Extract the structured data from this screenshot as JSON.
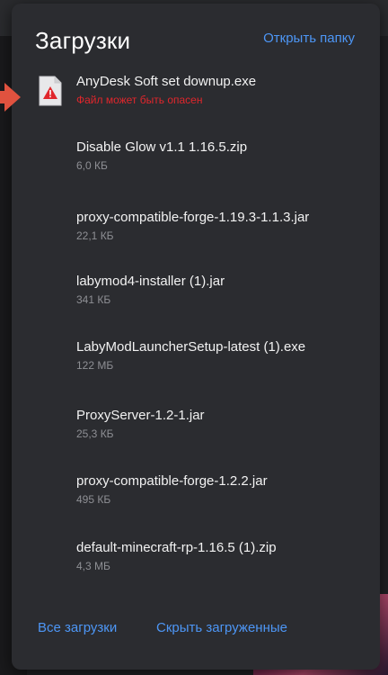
{
  "header": {
    "title": "Загрузки",
    "open_folder": "Открыть папку"
  },
  "downloads": [
    {
      "name": "AnyDesk Soft set downup.exe",
      "meta": "Файл может быть опасен",
      "warning": true
    },
    {
      "name": "Disable Glow v1.1 1.16.5.zip",
      "meta": "6,0 КБ"
    },
    {
      "name": "proxy-compatible-forge-1.19.3-1.1.3.jar",
      "meta": "22,1 КБ"
    },
    {
      "name": "labymod4-installer (1).jar",
      "meta": "341 КБ"
    },
    {
      "name": "LabyModLauncherSetup-latest (1).exe",
      "meta": "122 МБ"
    },
    {
      "name": "ProxyServer-1.2-1.jar",
      "meta": "25,3 КБ"
    },
    {
      "name": "proxy-compatible-forge-1.2.2.jar",
      "meta": "495 КБ"
    },
    {
      "name": "default-minecraft-rp-1.16.5 (1).zip",
      "meta": "4,3 МБ"
    }
  ],
  "footer": {
    "all_downloads": "Все загрузки",
    "hide_downloaded": "Скрыть загруженные"
  },
  "colors": {
    "panel_bg": "#2b2c30",
    "link": "#4d96f5",
    "danger": "#e0262c",
    "arrow": "#e0523f"
  },
  "icons": {
    "warning_file": "file-warning-icon",
    "pointer": "arrow-right-icon"
  }
}
